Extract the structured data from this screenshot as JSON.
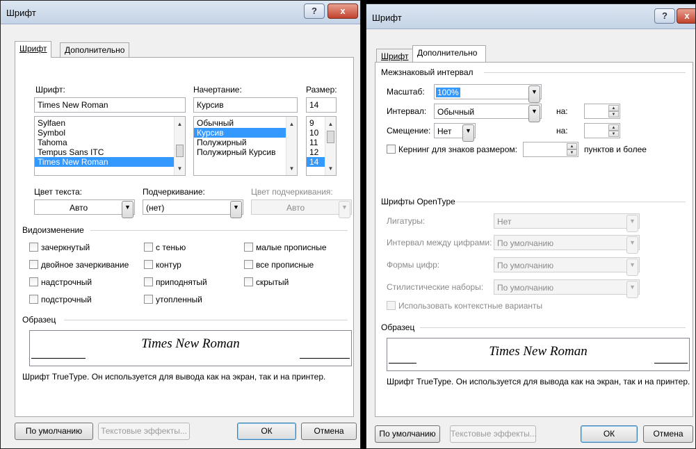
{
  "left_dialog": {
    "title": "Шрифт",
    "help": "?",
    "close": "x",
    "tabs": [
      "Шрифт",
      "Дополнительно"
    ],
    "font_label": "Шрифт:",
    "style_label": "Начертание:",
    "size_label": "Размер:",
    "font_value": "Times New Roman",
    "style_value": "Курсив",
    "size_value": "14",
    "font_list": [
      "Sylfaen",
      "Symbol",
      "Tahoma",
      "Tempus Sans ITC",
      "Times New Roman"
    ],
    "style_list": [
      "Обычный",
      "Курсив",
      "Полужирный",
      "Полужирный Курсив"
    ],
    "size_list": [
      "9",
      "10",
      "11",
      "12",
      "14"
    ],
    "text_color_label": "Цвет текста:",
    "text_color_value": "Авто",
    "underline_label": "Подчеркивание:",
    "underline_value": "(нет)",
    "underline_color_label": "Цвет подчеркивания:",
    "underline_color_value": "Авто",
    "effects_title": "Видоизменение",
    "effects_col1": [
      "зачеркнутый",
      "двойное зачеркивание",
      "надстрочный",
      "подстрочный"
    ],
    "effects_col2": [
      "с тенью",
      "контур",
      "приподнятый",
      "утопленный"
    ],
    "effects_col3": [
      "малые прописные",
      "все прописные",
      "скрытый"
    ],
    "sample_title": "Образец",
    "sample_text": "Times New Roman",
    "description": "Шрифт TrueType. Он используется для вывода как на экран, так и на принтер.",
    "default_button": "По умолчанию",
    "text_effects_button": "Текстовые эффекты...",
    "ok_button": "ОК",
    "cancel_button": "Отмена"
  },
  "right_dialog": {
    "title": "Шрифт",
    "help": "?",
    "close": "x",
    "tabs": [
      "Шрифт",
      "Дополнительно"
    ],
    "spacing_title": "Межзнаковый интервал",
    "scale_label": "Масштаб:",
    "scale_value": "100%",
    "interval_label": "Интервал:",
    "interval_value": "Обычный",
    "interval_by": "на:",
    "offset_label": "Смещение:",
    "offset_value": "Нет",
    "offset_by": "на:",
    "kerning_label": "Кернинг для знаков размером:",
    "kerning_suffix": "пунктов и более",
    "opentype_title": "Шрифты OpenType",
    "ligatures_label": "Лигатуры:",
    "ligatures_value": "Нет",
    "num_spacing_label": "Интервал между цифрами:",
    "num_spacing_value": "По умолчанию",
    "num_forms_label": "Формы цифр:",
    "num_forms_value": "По умолчанию",
    "stylistic_label": "Стилистические наборы:",
    "stylistic_value": "По умолчанию",
    "contextual_label": "Использовать контекстные варианты",
    "sample_title": "Образец",
    "sample_text": "Times New Roman",
    "description": "Шрифт TrueType. Он используется для вывода как на экран, так и на принтер.",
    "default_button": "По умолчанию",
    "text_effects_button": "Текстовые эффекты...",
    "ok_button": "ОК",
    "cancel_button": "Отмена"
  }
}
